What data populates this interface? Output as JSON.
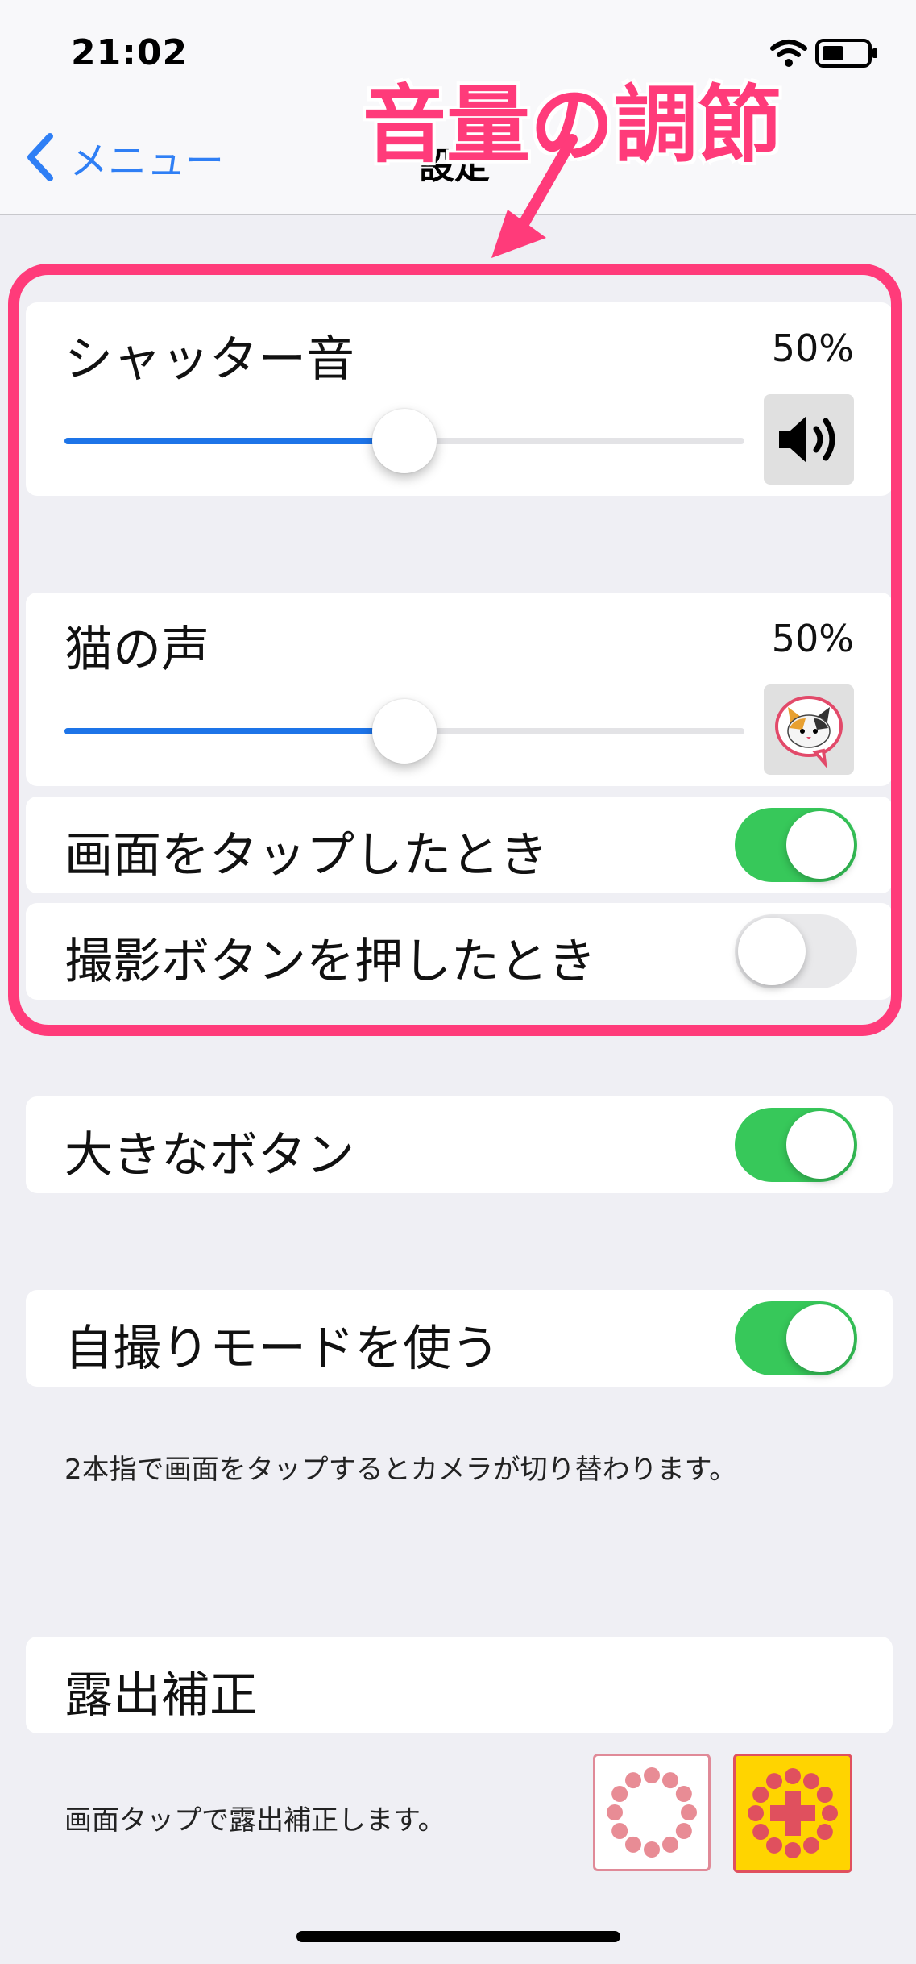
{
  "status_bar": {
    "time": "21:02",
    "battery_level": 0.5
  },
  "nav": {
    "back_label": "メニュー",
    "title": "設定"
  },
  "annotation": {
    "callout": "音量の調節",
    "color": "#ff3b7a"
  },
  "volume": {
    "shutter": {
      "label": "シャッター音",
      "percent_text": "50%",
      "value": 0.5,
      "icon": "speaker-icon"
    },
    "cat": {
      "label": "猫の声",
      "percent_text": "50%",
      "value": 0.5,
      "icon": "cat-speech-icon"
    }
  },
  "toggles": {
    "tap_screen": {
      "label": "画面をタップしたとき",
      "on": true
    },
    "shutter_button": {
      "label": "撮影ボタンを押したとき",
      "on": false
    },
    "big_button": {
      "label": "大きなボタン",
      "on": true
    },
    "selfie": {
      "label": "自撮りモードを使う",
      "on": true
    }
  },
  "selfie_caption": "2本指で画面をタップするとカメラが切り替わります。",
  "exposure": {
    "label": "露出補正",
    "caption": "画面タップで露出補正します。",
    "options": [
      "exposure-off-icon",
      "exposure-on-icon"
    ]
  },
  "colors": {
    "accent": "#1d74e8",
    "toggle_on": "#37c85a",
    "highlight": "#ff3b7a",
    "back": "#2f7ff5"
  }
}
